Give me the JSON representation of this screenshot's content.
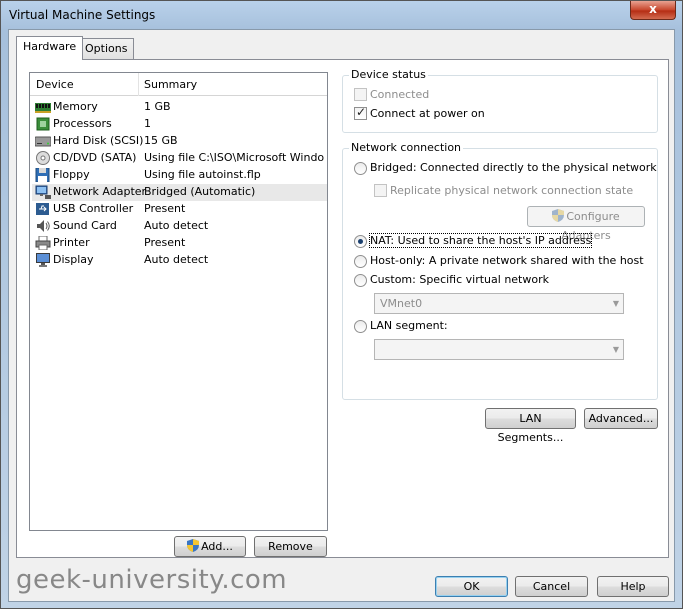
{
  "window": {
    "title": "Virtual Machine Settings",
    "close_glyph": "x"
  },
  "tabs": [
    {
      "label": "Hardware",
      "active": true
    },
    {
      "label": "Options",
      "active": false
    }
  ],
  "device_list": {
    "col_device": "Device",
    "col_summary": "Summary",
    "rows": [
      {
        "name": "Memory",
        "summary": "1 GB",
        "icon": "memory-icon"
      },
      {
        "name": "Processors",
        "summary": "1",
        "icon": "processor-icon"
      },
      {
        "name": "Hard Disk (SCSI)",
        "summary": "15 GB",
        "icon": "hard-disk-icon"
      },
      {
        "name": "CD/DVD (SATA)",
        "summary": "Using file C:\\ISO\\Microsoft Windo...",
        "icon": "cd-dvd-icon"
      },
      {
        "name": "Floppy",
        "summary": "Using file autoinst.flp",
        "icon": "floppy-icon"
      },
      {
        "name": "Network Adapter",
        "summary": "Bridged (Automatic)",
        "icon": "network-adapter-icon"
      },
      {
        "name": "USB Controller",
        "summary": "Present",
        "icon": "usb-icon"
      },
      {
        "name": "Sound Card",
        "summary": "Auto detect",
        "icon": "sound-card-icon"
      },
      {
        "name": "Printer",
        "summary": "Present",
        "icon": "printer-icon"
      },
      {
        "name": "Display",
        "summary": "Auto detect",
        "icon": "display-icon"
      }
    ],
    "selected": "Network Adapter"
  },
  "list_buttons": {
    "add": "Add...",
    "remove": "Remove"
  },
  "device_status": {
    "title": "Device status",
    "connected": "Connected",
    "connected_checked": false,
    "connect_at_power_on": "Connect at power on",
    "connect_at_power_on_checked": true
  },
  "network_connection": {
    "title": "Network connection",
    "bridged": "Bridged: Connected directly to the physical network",
    "replicate": "Replicate physical network connection state",
    "configure_adapters": "Configure Adapters",
    "nat": "NAT: Used to share the host's IP address",
    "host_only": "Host-only: A private network shared with the host",
    "custom": "Custom: Specific virtual network",
    "custom_value": "VMnet0",
    "lan_segment": "LAN segment:",
    "lan_segment_value": "",
    "selected": "nat"
  },
  "right_buttons": {
    "lan_segments": "LAN Segments...",
    "advanced": "Advanced..."
  },
  "footer": {
    "ok": "OK",
    "cancel": "Cancel",
    "help": "Help"
  },
  "watermark": "geek-university.com",
  "colors": {
    "selected_row": "#e8e8e8",
    "titlebar": "#b9d1ea",
    "close_button": "#c7462c"
  }
}
